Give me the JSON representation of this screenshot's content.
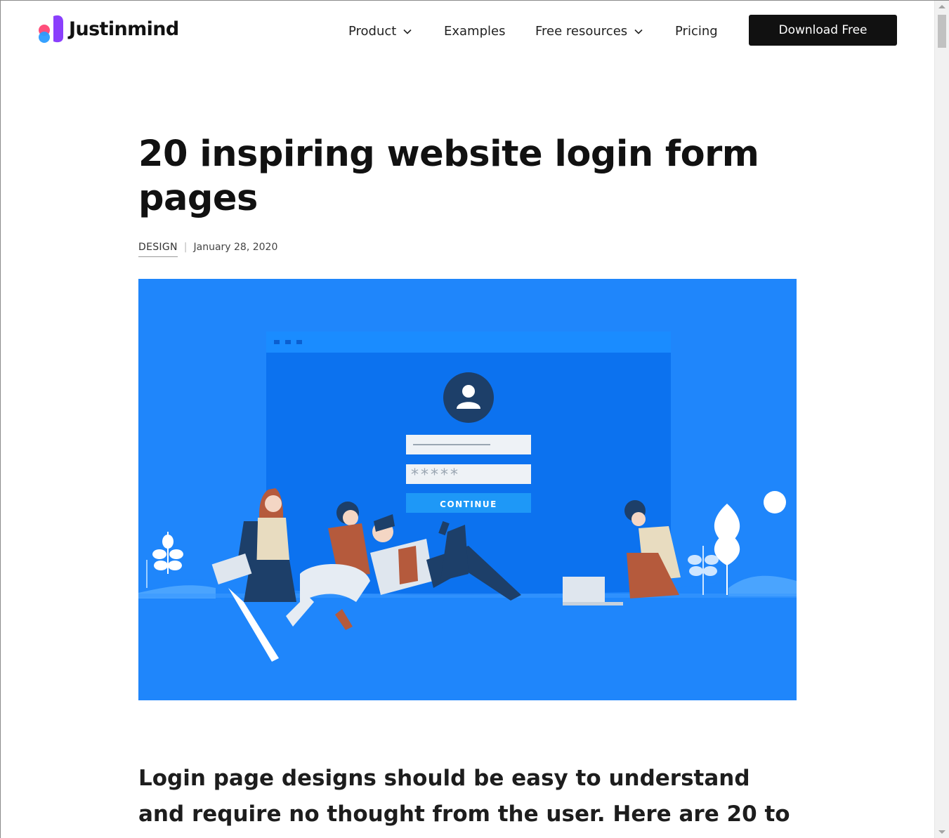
{
  "brand": {
    "name": "Justinmind"
  },
  "nav": {
    "items": [
      {
        "label": "Product",
        "has_dropdown": true
      },
      {
        "label": "Examples",
        "has_dropdown": false
      },
      {
        "label": "Free resources",
        "has_dropdown": true
      },
      {
        "label": "Pricing",
        "has_dropdown": false
      }
    ],
    "cta_label": "Download Free"
  },
  "article": {
    "title": "20 inspiring website login form pages",
    "category": "DESIGN",
    "date": "January 28, 2020",
    "lead": "Login page designs should be easy to understand and require no thought from the user. Here are 20 to"
  },
  "hero": {
    "password_mask": "*****",
    "button_label": "CONTINUE"
  },
  "colors": {
    "hero_bg": "#1f86fb",
    "cta_bg": "#111111",
    "logo_pink": "#ff4f7b",
    "logo_blue": "#2b9cff",
    "logo_purple": "#8a3ffc"
  },
  "icons": [
    "chevron-down-icon",
    "user-icon",
    "justinmind-logo-icon"
  ]
}
